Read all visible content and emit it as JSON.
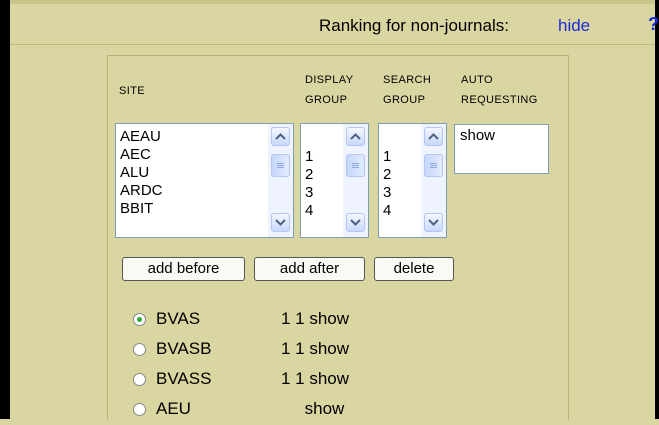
{
  "ranking": {
    "label": "Ranking for non-journals:",
    "hide_link": "hide",
    "help": "?"
  },
  "headers": {
    "site": "SITE",
    "display_group_1": "DISPLAY",
    "display_group_2": "GROUP",
    "search_group_1": "SEARCH",
    "search_group_2": "GROUP",
    "auto_1": "AUTO",
    "auto_2": "REQUESTING"
  },
  "site_list": [
    "AEAU",
    "AEC",
    "ALU",
    "ARDC",
    "BBIT"
  ],
  "display_group_list": [
    "1",
    "2",
    "3",
    "4"
  ],
  "search_group_list": [
    "1",
    "2",
    "3",
    "4"
  ],
  "auto_requesting_list": [
    "show"
  ],
  "buttons": {
    "add_before": "add before",
    "add_after": "add after",
    "delete": "delete"
  },
  "entries": [
    {
      "name": "BVAS",
      "value": "1 1 show",
      "selected": true
    },
    {
      "name": "BVASB",
      "value": "1 1 show",
      "selected": false
    },
    {
      "name": "BVASS",
      "value": "1 1 show",
      "selected": false
    },
    {
      "name": "AEU",
      "value": "     show",
      "selected": false
    }
  ],
  "colors": {
    "background": "#d9d6a1",
    "link": "#1d2ad8",
    "radio_selected": "#2fae3a"
  }
}
